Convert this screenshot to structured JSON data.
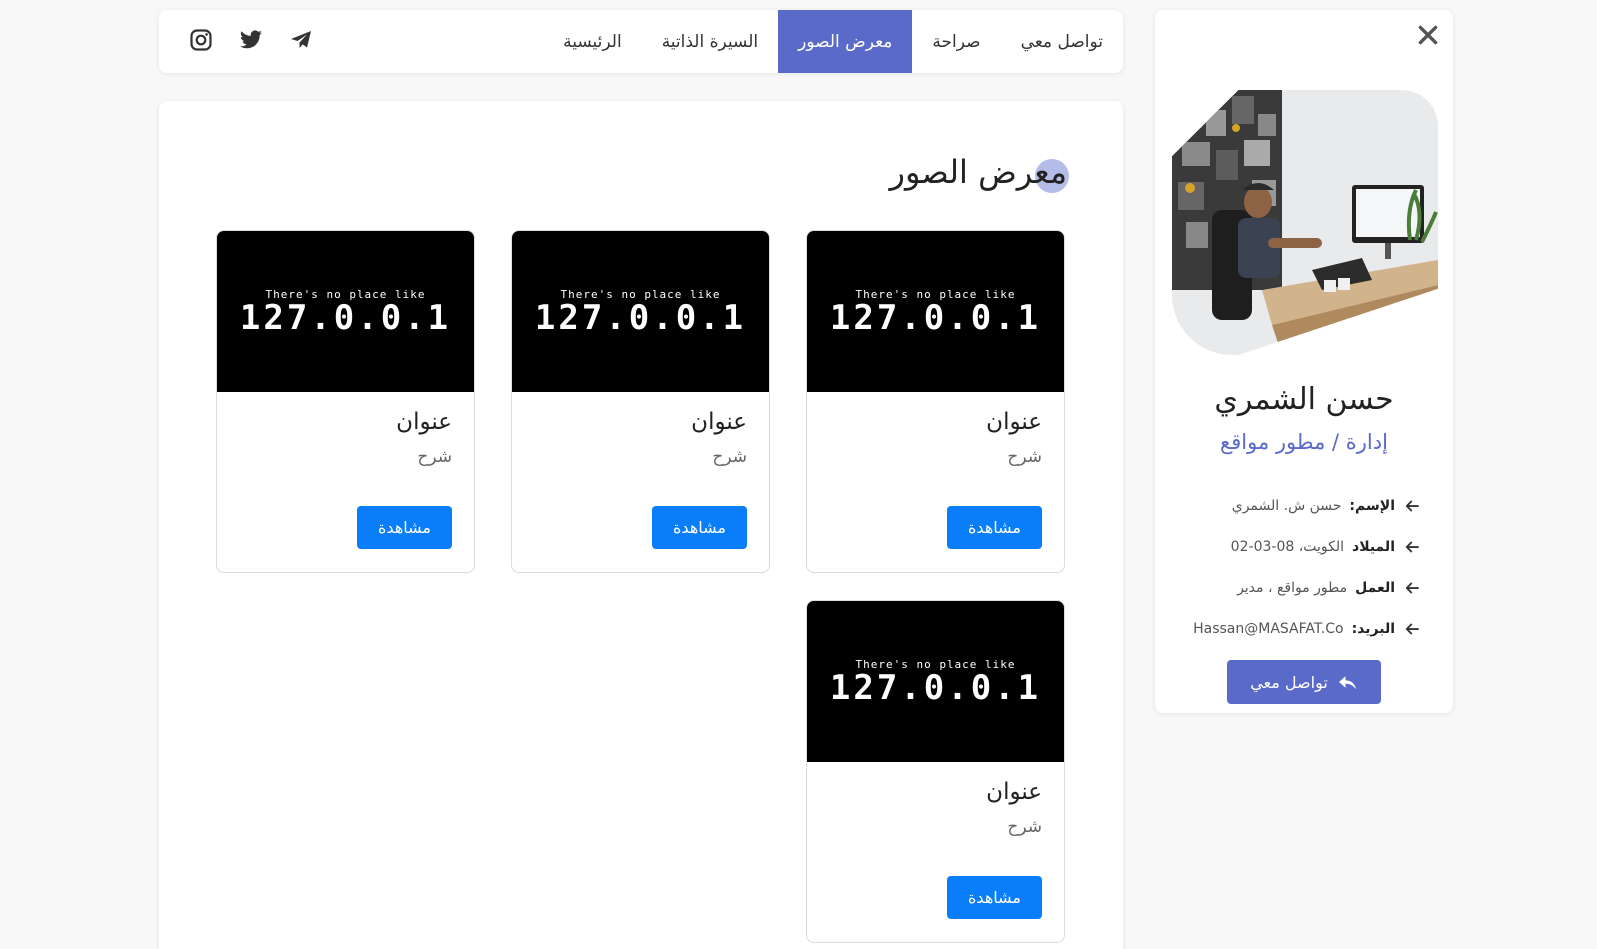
{
  "profile": {
    "name": "حسن الشمري",
    "role": "إدارة / مطور مواقع",
    "info": [
      {
        "key": "الإسم:",
        "value": "حسن ش. الشمري"
      },
      {
        "key": "الميلاد",
        "value": "الكويت، 08-03-02"
      },
      {
        "key": "العمل",
        "value": "مطور مواقع ، مدير"
      },
      {
        "key": "البريد:",
        "value": "Hassan@MASAFAT.Co"
      }
    ],
    "contact_label": "تواصل معي"
  },
  "nav": {
    "tabs": [
      "الرئيسية",
      "السيرة الذاتية",
      "معرض الصور",
      "صراحة",
      "تواصل معي"
    ],
    "active_tab": "معرض الصور"
  },
  "gallery": {
    "title": "معرض الصور",
    "cards": [
      {
        "image_small": "There's no place like",
        "image_big": "127.0.0.1",
        "title": "عنوان",
        "desc": "شرح",
        "button": "مشاهدة"
      },
      {
        "image_small": "There's no place like",
        "image_big": "127.0.0.1",
        "title": "عنوان",
        "desc": "شرح",
        "button": "مشاهدة"
      },
      {
        "image_small": "There's no place like",
        "image_big": "127.0.0.1",
        "title": "عنوان",
        "desc": "شرح",
        "button": "مشاهدة"
      },
      {
        "image_small": "There's no place like",
        "image_big": "127.0.0.1",
        "title": "عنوان",
        "desc": "شرح",
        "button": "مشاهدة"
      }
    ]
  },
  "colors": {
    "accent": "#5a6ac9",
    "button_blue": "#0a7ef9"
  },
  "icons": {
    "close": "close-icon",
    "info_arrow": "arrow-left-icon",
    "contact": "reply-icon",
    "social": [
      "instagram-icon",
      "twitter-icon",
      "telegram-icon"
    ]
  }
}
